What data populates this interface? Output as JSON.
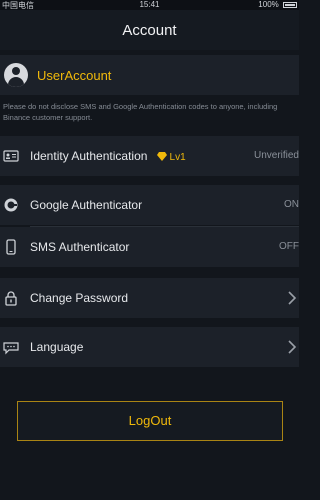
{
  "status_bar": {
    "carrier": "中国电信",
    "time": "15:41",
    "battery": "100%"
  },
  "header": {
    "title": "Account"
  },
  "account": {
    "username": "UserAccount"
  },
  "notice": "Please do not disclose SMS and Google Authentication codes to anyone, including Binance customer support.",
  "rows": [
    {
      "label": "Identity Authentication",
      "level": "Lv1",
      "value": "Unverified"
    },
    {
      "label": "Google Authenticator",
      "value": "ON"
    },
    {
      "label": "SMS Authenticator",
      "value": "OFF"
    },
    {
      "label": "Change Password"
    },
    {
      "label": "Language"
    }
  ],
  "logout_label": "LogOut",
  "colors": {
    "accent": "#f0b90b",
    "background": "#12161c",
    "panel": "#1c2129"
  }
}
